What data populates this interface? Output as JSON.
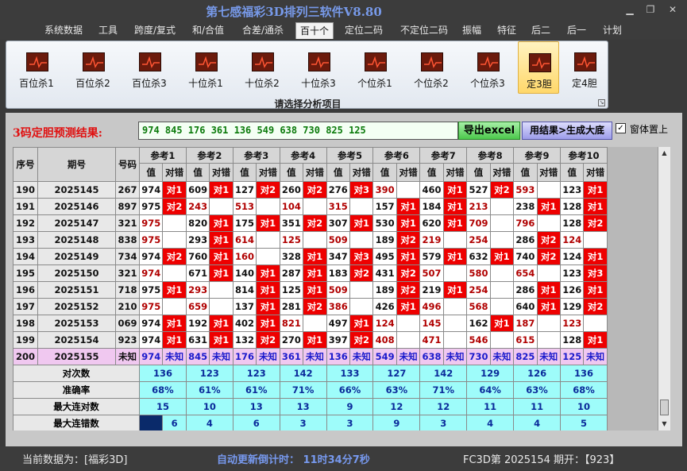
{
  "window": {
    "title": "第七感福彩3D排列三软件V8.80"
  },
  "menu": [
    "系统数据",
    "工具",
    "跨度/复式",
    "和/合值",
    "合差/通杀",
    "百十个",
    "定位二码",
    "不定位二码",
    "振幅",
    "特征",
    "后二",
    "后一",
    "计划"
  ],
  "ribbon": {
    "buttons": [
      "百位杀1",
      "百位杀2",
      "百位杀3",
      "十位杀1",
      "十位杀2",
      "十位杀3",
      "个位杀1",
      "个位杀2",
      "个位杀3",
      "定3胆",
      "定4胆"
    ],
    "caption": "请选择分析项目",
    "selected": "定3胆"
  },
  "prediction": {
    "label": "3码定胆预测结果:",
    "value": "974 845 176 361 136 549 638 730 825 125"
  },
  "buttons": {
    "export": "导出excel",
    "generate": "用结果>生成大底"
  },
  "option": {
    "on_top_label": "窗体置上",
    "on_top_checked": true,
    "check_mark": "✓"
  },
  "table": {
    "headers": {
      "idx": "序号",
      "period": "期号",
      "number": "号码",
      "value": "值",
      "result": "对错"
    },
    "refs": [
      "参考1",
      "参考2",
      "参考3",
      "参考4",
      "参考5",
      "参考6",
      "参考7",
      "参考8",
      "参考9",
      "参考10"
    ],
    "rows": [
      {
        "idx": "190",
        "period": "2025145",
        "number": "267",
        "cells": [
          [
            "974",
            "对1"
          ],
          [
            "609",
            "对1"
          ],
          [
            "127",
            "对2"
          ],
          [
            "260",
            "对2"
          ],
          [
            "276",
            "对3"
          ],
          [
            "390",
            ""
          ],
          [
            "460",
            "对1"
          ],
          [
            "527",
            "对2"
          ],
          [
            "593",
            ""
          ],
          [
            "123",
            "对1"
          ]
        ]
      },
      {
        "idx": "191",
        "period": "2025146",
        "number": "897",
        "cells": [
          [
            "975",
            "对2"
          ],
          [
            "243",
            ""
          ],
          [
            "513",
            ""
          ],
          [
            "104",
            ""
          ],
          [
            "315",
            ""
          ],
          [
            "157",
            "对1"
          ],
          [
            "184",
            "对1"
          ],
          [
            "213",
            ""
          ],
          [
            "238",
            "对1"
          ],
          [
            "128",
            "对1"
          ]
        ]
      },
      {
        "idx": "192",
        "period": "2025147",
        "number": "321",
        "cells": [
          [
            "975",
            ""
          ],
          [
            "820",
            "对1"
          ],
          [
            "175",
            "对1"
          ],
          [
            "351",
            "对2"
          ],
          [
            "307",
            "对1"
          ],
          [
            "530",
            "对1"
          ],
          [
            "620",
            "对1"
          ],
          [
            "709",
            ""
          ],
          [
            "796",
            ""
          ],
          [
            "128",
            "对2"
          ]
        ]
      },
      {
        "idx": "193",
        "period": "2025148",
        "number": "838",
        "cells": [
          [
            "975",
            ""
          ],
          [
            "293",
            "对1"
          ],
          [
            "614",
            ""
          ],
          [
            "125",
            ""
          ],
          [
            "509",
            ""
          ],
          [
            "189",
            "对2"
          ],
          [
            "219",
            ""
          ],
          [
            "254",
            ""
          ],
          [
            "286",
            "对2"
          ],
          [
            "124",
            ""
          ]
        ]
      },
      {
        "idx": "194",
        "period": "2025149",
        "number": "734",
        "cells": [
          [
            "974",
            "对2"
          ],
          [
            "760",
            "对1"
          ],
          [
            "160",
            ""
          ],
          [
            "328",
            "对1"
          ],
          [
            "347",
            "对3"
          ],
          [
            "495",
            "对1"
          ],
          [
            "579",
            "对1"
          ],
          [
            "632",
            "对1"
          ],
          [
            "740",
            "对2"
          ],
          [
            "124",
            "对1"
          ]
        ]
      },
      {
        "idx": "195",
        "period": "2025150",
        "number": "321",
        "cells": [
          [
            "974",
            ""
          ],
          [
            "671",
            "对1"
          ],
          [
            "140",
            "对1"
          ],
          [
            "287",
            "对1"
          ],
          [
            "183",
            "对2"
          ],
          [
            "431",
            "对2"
          ],
          [
            "507",
            ""
          ],
          [
            "580",
            ""
          ],
          [
            "654",
            ""
          ],
          [
            "123",
            "对3"
          ]
        ]
      },
      {
        "idx": "196",
        "period": "2025151",
        "number": "718",
        "cells": [
          [
            "975",
            "对1"
          ],
          [
            "293",
            ""
          ],
          [
            "814",
            "对1"
          ],
          [
            "125",
            "对1"
          ],
          [
            "509",
            ""
          ],
          [
            "189",
            "对2"
          ],
          [
            "219",
            "对1"
          ],
          [
            "254",
            ""
          ],
          [
            "286",
            "对1"
          ],
          [
            "126",
            "对1"
          ]
        ]
      },
      {
        "idx": "197",
        "period": "2025152",
        "number": "210",
        "cells": [
          [
            "975",
            ""
          ],
          [
            "659",
            ""
          ],
          [
            "137",
            "对1"
          ],
          [
            "281",
            "对2"
          ],
          [
            "386",
            ""
          ],
          [
            "426",
            "对1"
          ],
          [
            "496",
            ""
          ],
          [
            "568",
            ""
          ],
          [
            "640",
            "对1"
          ],
          [
            "129",
            "对2"
          ]
        ]
      },
      {
        "idx": "198",
        "period": "2025153",
        "number": "069",
        "cells": [
          [
            "974",
            "对1"
          ],
          [
            "192",
            "对1"
          ],
          [
            "402",
            "对1"
          ],
          [
            "821",
            ""
          ],
          [
            "497",
            "对1"
          ],
          [
            "124",
            ""
          ],
          [
            "145",
            ""
          ],
          [
            "162",
            "对1"
          ],
          [
            "187",
            ""
          ],
          [
            "123",
            ""
          ]
        ]
      },
      {
        "idx": "199",
        "period": "2025154",
        "number": "923",
        "cells": [
          [
            "974",
            "对1"
          ],
          [
            "631",
            "对1"
          ],
          [
            "132",
            "对2"
          ],
          [
            "270",
            "对1"
          ],
          [
            "397",
            "对2"
          ],
          [
            "408",
            ""
          ],
          [
            "471",
            ""
          ],
          [
            "546",
            ""
          ],
          [
            "615",
            ""
          ],
          [
            "128",
            "对1"
          ]
        ]
      },
      {
        "idx": "200",
        "period": "2025155",
        "number": "未知",
        "cells": [
          [
            "974",
            "未知"
          ],
          [
            "845",
            "未知"
          ],
          [
            "176",
            "未知"
          ],
          [
            "361",
            "未知"
          ],
          [
            "136",
            "未知"
          ],
          [
            "549",
            "未知"
          ],
          [
            "638",
            "未知"
          ],
          [
            "730",
            "未知"
          ],
          [
            "825",
            "未知"
          ],
          [
            "125",
            "未知"
          ]
        ]
      }
    ],
    "stats": [
      {
        "label": "对次数",
        "values": [
          "136",
          "123",
          "123",
          "142",
          "133",
          "127",
          "142",
          "129",
          "126",
          "136"
        ]
      },
      {
        "label": "准确率",
        "values": [
          "68%",
          "61%",
          "61%",
          "71%",
          "66%",
          "63%",
          "71%",
          "64%",
          "63%",
          "68%"
        ]
      },
      {
        "label": "最大连对数",
        "values": [
          "15",
          "10",
          "13",
          "13",
          "9",
          "12",
          "12",
          "11",
          "11",
          "10"
        ]
      },
      {
        "label": "最大连错数",
        "values": [
          "6",
          "4",
          "6",
          "3",
          "3",
          "9",
          "3",
          "4",
          "4",
          "5"
        ]
      }
    ]
  },
  "status": {
    "data_source": "当前数据为：[福彩3D]",
    "countdown": "自动更新倒计时：  11时34分7秒",
    "draw_info": "FC3D第 2025154 期开：【923】"
  },
  "colors": {
    "hit": "#ee0000",
    "stats_bg": "#9efcfa",
    "pending_row": "#f0c8f0",
    "miss_value": "#b00000"
  }
}
